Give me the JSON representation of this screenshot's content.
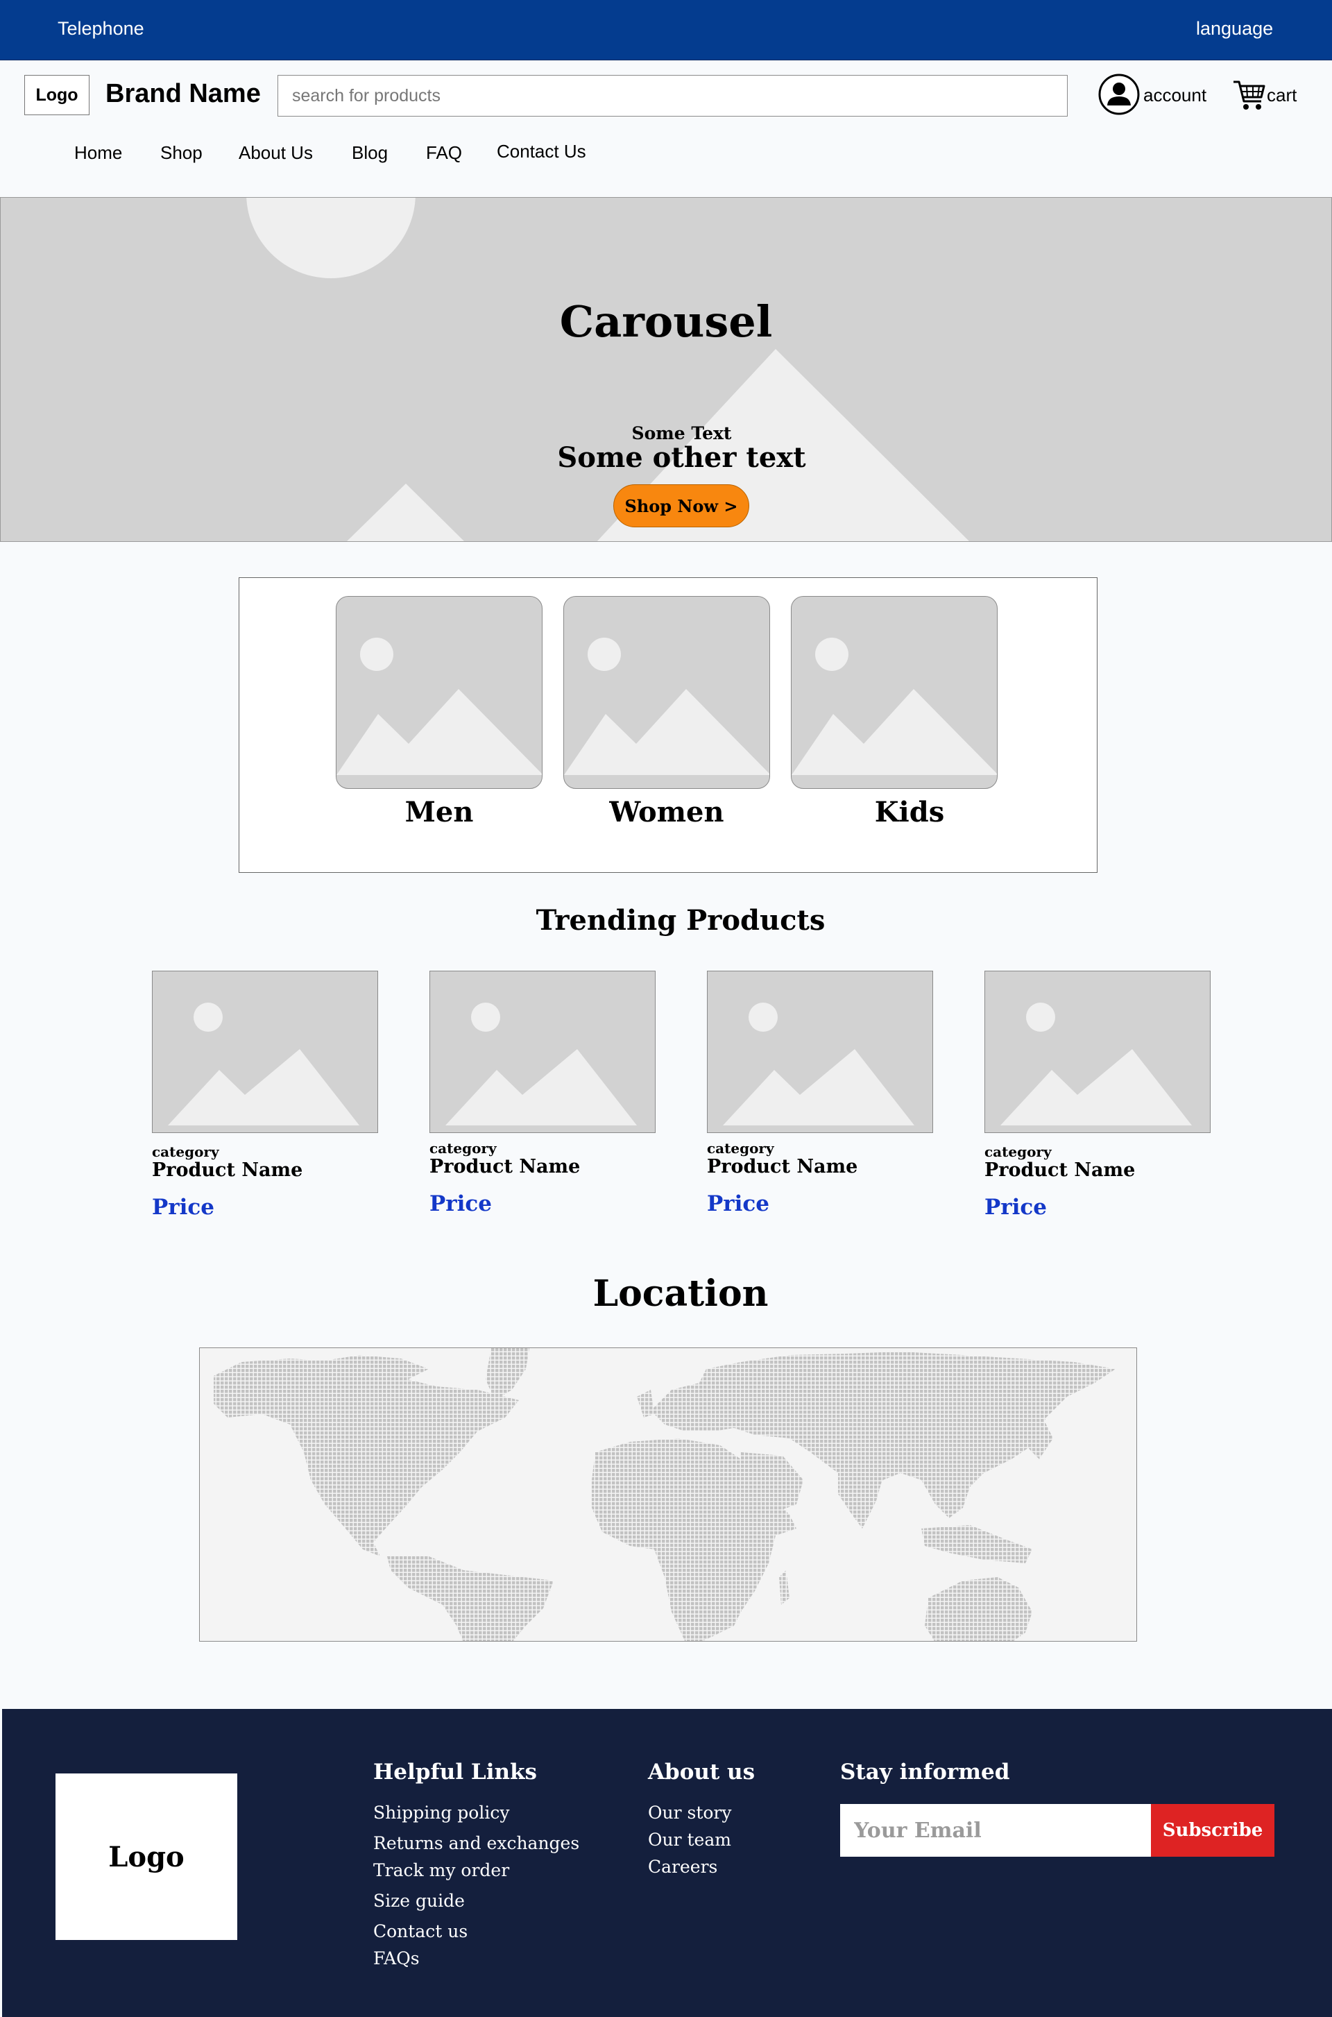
{
  "topbar": {
    "telephone": "Telephone",
    "language": "language",
    "color": "#043c8f"
  },
  "header": {
    "logo": "Logo",
    "brand": "Brand Name",
    "search_placeholder": "search for products",
    "search_icon": "",
    "account_label": "account",
    "cart_label": "cart",
    "account_icon": "user-circle-icon",
    "cart_icon": "shopping-cart-icon"
  },
  "nav": {
    "items": [
      "Home",
      "Shop",
      "About Us",
      "Blog",
      "FAQ",
      "Contact Us"
    ]
  },
  "carousel": {
    "title": "Carousel",
    "subtitle": "Some Text",
    "headline": "Some other text",
    "button": "Shop Now >",
    "button_color": "#f8870f"
  },
  "categories": {
    "items": [
      "Men",
      "Women",
      "Kids"
    ]
  },
  "trending": {
    "title": "Trending Products",
    "products": [
      {
        "category": "category",
        "name": "Product Name",
        "price": "Price"
      },
      {
        "category": "category",
        "name": "Product Name",
        "price": "Price"
      },
      {
        "category": "category",
        "name": "Product Name",
        "price": "Price"
      },
      {
        "category": "category",
        "name": "Product Name",
        "price": "Price"
      }
    ],
    "price_color": "#1438c8"
  },
  "location": {
    "title": "Location"
  },
  "footer": {
    "logo": "Logo",
    "helpful_title": "Helpful Links",
    "helpful_links": [
      "Shipping policy",
      "Returns and exchanges",
      "Track my order",
      "Size guide",
      "Contact us",
      "FAQs"
    ],
    "about_title": "About us",
    "about_links": [
      "Our story",
      "Our team",
      "Careers"
    ],
    "newsletter_title": "Stay informed",
    "email_placeholder": "Your Email",
    "subscribe": "Subscribe",
    "background": "#141f3d",
    "subscribe_color": "#de2323"
  }
}
